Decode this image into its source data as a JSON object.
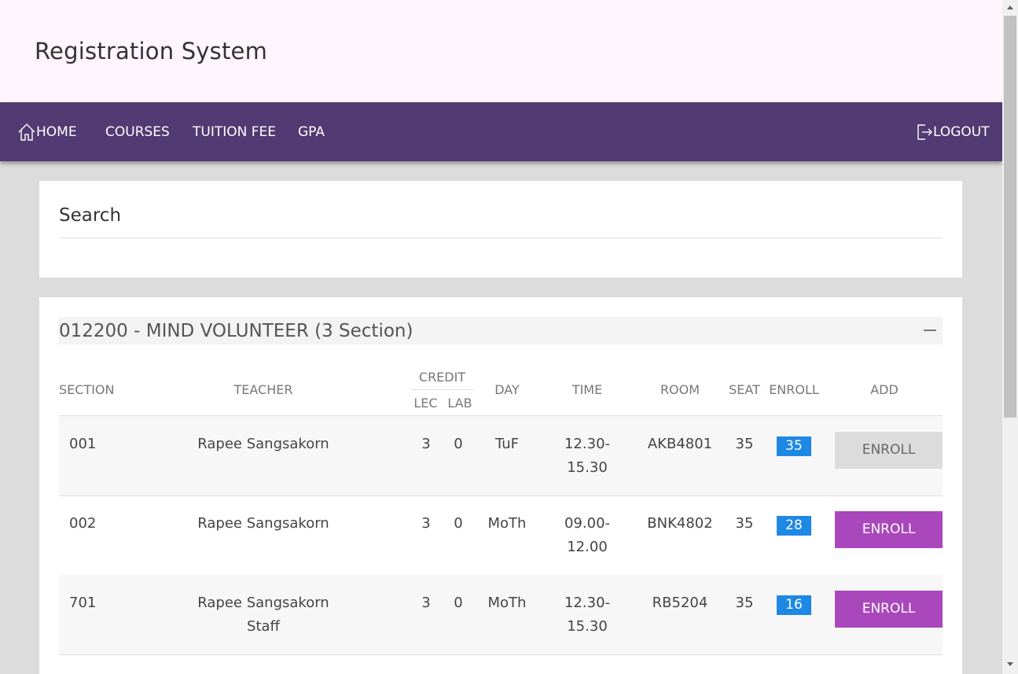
{
  "header": {
    "title": "Registration System"
  },
  "nav": {
    "home": "HOME",
    "courses": "COURSES",
    "tuition": "TUITION FEE",
    "gpa": "GPA",
    "logout": "LOGOUT",
    "home_icon": "home-icon",
    "logout_icon": "logout-icon"
  },
  "search": {
    "title": "Search"
  },
  "course": {
    "title": "012200 - MIND VOLUNTEER (3 Section)",
    "columns": {
      "section": "SECTION",
      "teacher": "TEACHER",
      "credit": "CREDIT",
      "lec": "LEC",
      "lab": "LAB",
      "day": "DAY",
      "time": "TIME",
      "room": "ROOM",
      "seat": "SEAT",
      "enroll": "ENROLL",
      "add": "ADD"
    },
    "rows": [
      {
        "section": "001",
        "teacher": "Rapee Sangsakorn",
        "teacher2": "",
        "lec": "3",
        "lab": "0",
        "day": "TuF",
        "time1": "12.30-",
        "time2": "15.30",
        "room": "AKB4801",
        "seat": "35",
        "enroll": "35",
        "button": "ENROLL",
        "button_state": "disabled"
      },
      {
        "section": "002",
        "teacher": "Rapee Sangsakorn",
        "teacher2": "",
        "lec": "3",
        "lab": "0",
        "day": "MoTh",
        "time1": "09.00-",
        "time2": "12.00",
        "room": "BNK4802",
        "seat": "35",
        "enroll": "28",
        "button": "ENROLL",
        "button_state": "active"
      },
      {
        "section": "701",
        "teacher": "Rapee Sangsakorn",
        "teacher2": "Staff",
        "lec": "3",
        "lab": "0",
        "day": "MoTh",
        "time1": "12.30-",
        "time2": "15.30",
        "room": "RB5204",
        "seat": "35",
        "enroll": "16",
        "button": "ENROLL",
        "button_state": "active"
      }
    ]
  },
  "colors": {
    "nav_bg": "#523a72",
    "header_bg": "#fef5fe",
    "enroll_active": "#ab47bc",
    "enroll_disabled": "#dcdcdc",
    "badge": "#1e88e5"
  }
}
